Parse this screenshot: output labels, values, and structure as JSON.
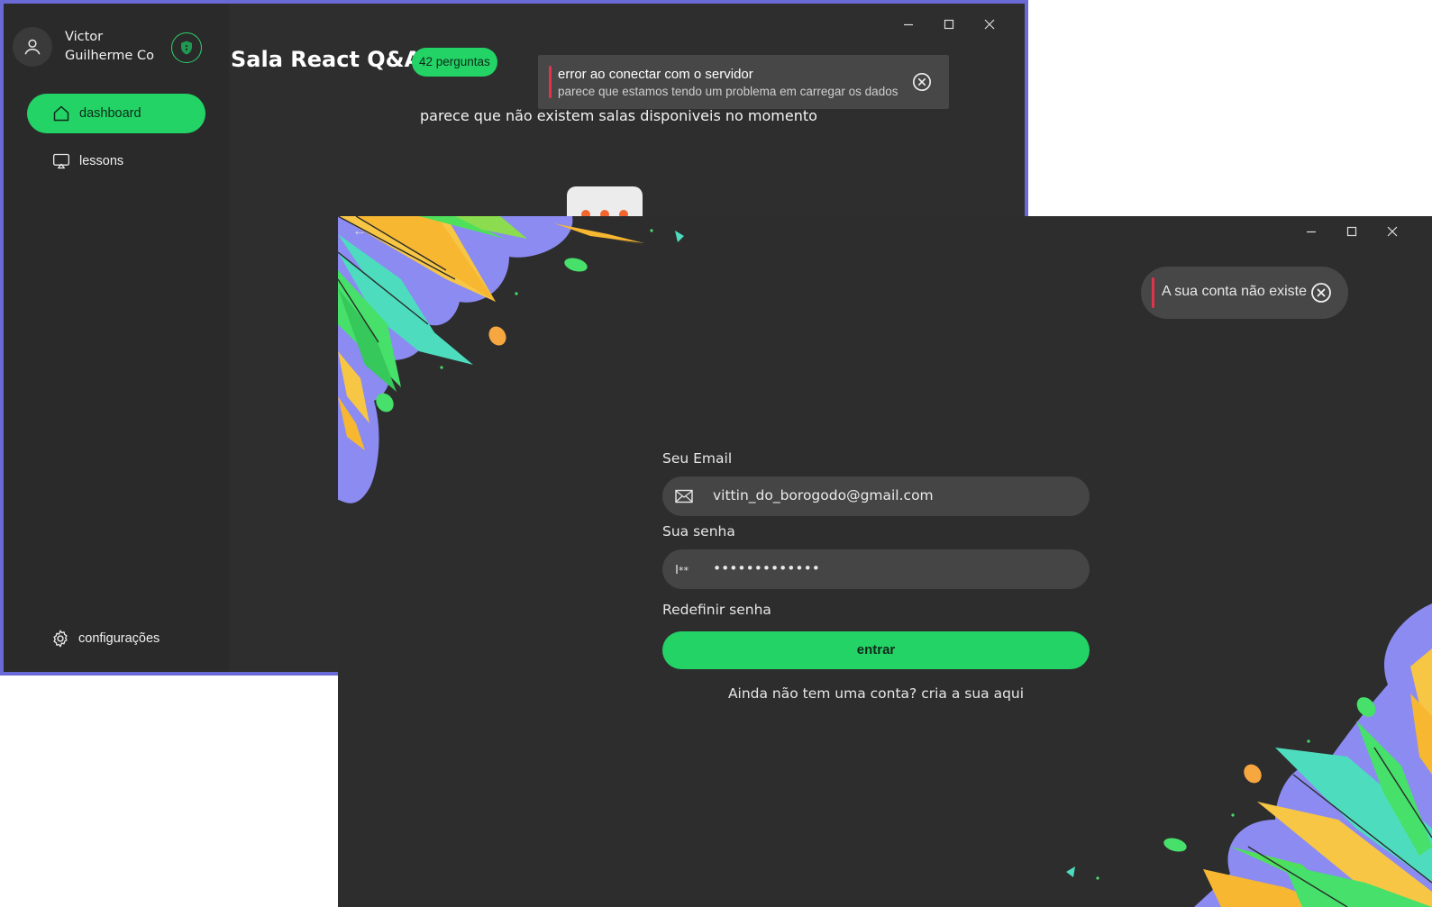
{
  "back_window": {
    "profile": {
      "name": "Victor Guilherme Co"
    },
    "nav": [
      {
        "label": "dashboard",
        "icon": "home-icon",
        "active": true
      },
      {
        "label": "lessons",
        "icon": "screen-cast-icon",
        "active": false
      }
    ],
    "settings_label": "configurações",
    "room_title": "Sala React Q&A",
    "question_badge": "42 perguntas",
    "empty_message": "parece que não existem salas disponiveis no momento",
    "error_toast": {
      "title": "error ao conectar com o servidor",
      "subtitle": "parece que estamos tendo um problema em carregar os dados"
    }
  },
  "front_window": {
    "toast": {
      "message": "A sua conta não existe"
    },
    "email": {
      "label": "Seu Email",
      "value": "vittin_do_borogodo@gmail.com"
    },
    "password": {
      "label": "Sua senha",
      "value": "•••••••••••••"
    },
    "reset_link": "Redefinir senha",
    "submit_label": "entrar",
    "signup_text": "Ainda não tem uma conta? cria a sua aqui"
  },
  "colors": {
    "accent": "#23d366",
    "background": "#2d2d2d",
    "error": "#e0344d",
    "window_border": "#6a6ad6"
  }
}
